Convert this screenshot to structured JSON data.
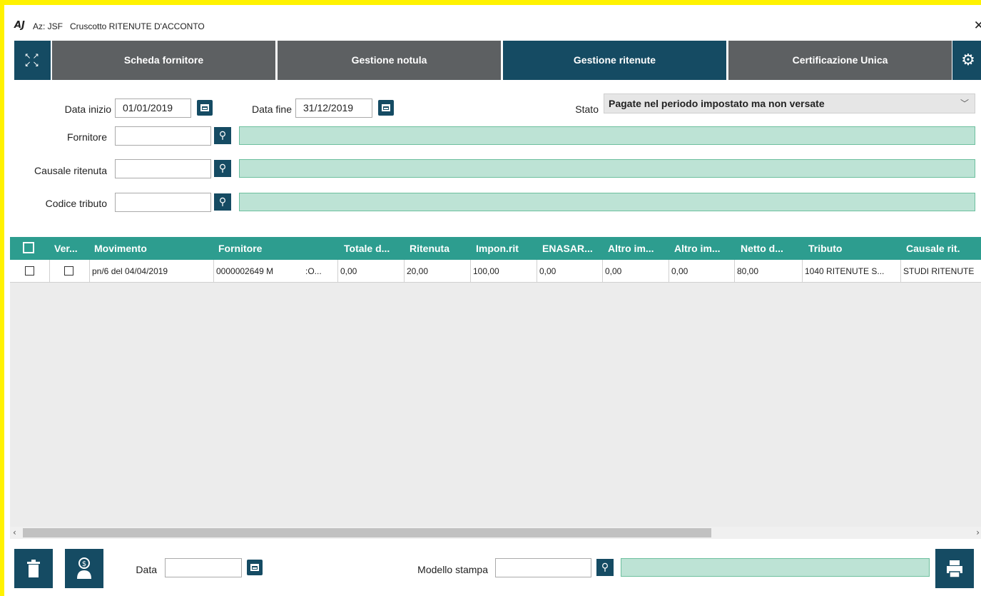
{
  "window": {
    "logo": "AJ",
    "company": "Az: JSF",
    "title": "Cruscotto RITENUTE D'ACCONTO",
    "close_icon": "close-icon"
  },
  "tabs": {
    "expand_icon": "expand-icon",
    "items": [
      {
        "label": "Scheda fornitore",
        "active": false
      },
      {
        "label": "Gestione notula",
        "active": false
      },
      {
        "label": "Gestione ritenute",
        "active": true
      },
      {
        "label": "Certificazione Unica",
        "active": false
      }
    ],
    "settings_icon": "gear-icon"
  },
  "filters": {
    "data_inizio_label": "Data inizio",
    "data_inizio_value": "01/01/2019",
    "data_fine_label": "Data fine",
    "data_fine_value": "31/12/2019",
    "stato_label": "Stato",
    "stato_value": "Pagate nel periodo impostato ma non versate",
    "fornitore_label": "Fornitore",
    "fornitore_value": "",
    "causale_label": "Causale ritenuta",
    "causale_value": "",
    "codice_tributo_label": "Codice tributo",
    "codice_tributo_value": ""
  },
  "grid": {
    "columns": [
      "Ver...",
      "Movimento",
      "Fornitore",
      "Totale d...",
      "Ritenuta",
      "Impon.rit",
      "ENASAR...",
      "Altro im...",
      "Altro im...",
      "Netto d...",
      "Tributo",
      "Causale rit."
    ],
    "rows": [
      {
        "selected": false,
        "verified": false,
        "movimento": "pn/6 del 04/04/2019",
        "fornitore": "0000002649 M",
        "fornitore_tail": ":O...",
        "totale": "0,00",
        "ritenuta": "20,00",
        "impon_rit": "100,00",
        "enasarco": "0,00",
        "altro_im1": "0,00",
        "altro_im2": "0,00",
        "netto": "80,00",
        "tributo": "1040 RITENUTE S...",
        "causale": "STUDI RITENUTE"
      }
    ]
  },
  "bottom": {
    "data_label": "Data",
    "data_value": "",
    "modello_label": "Modello stampa",
    "modello_value": ""
  },
  "colors": {
    "tab_active": "#154b63",
    "tab_inactive": "#5d6062",
    "grid_header": "#2d9d8f",
    "desc_field": "#bde3d5",
    "frame": "#fff200"
  }
}
